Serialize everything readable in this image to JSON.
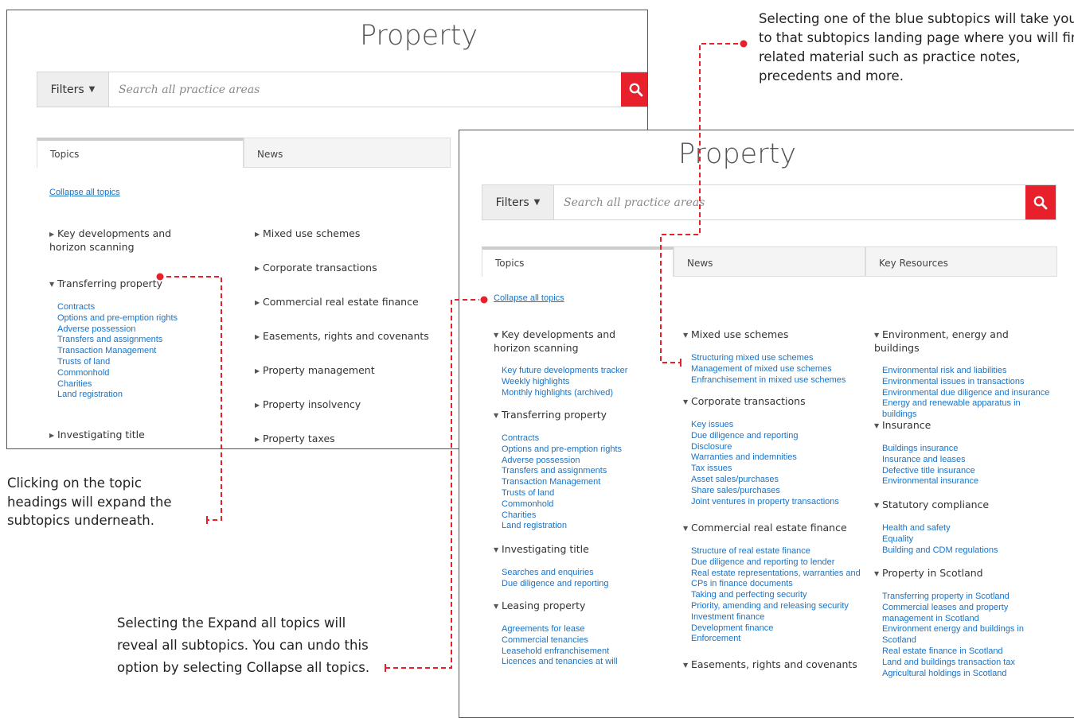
{
  "page_title": "Property",
  "search": {
    "filters_label": "Filters",
    "placeholder": "Search all practice areas"
  },
  "tabs_front": [
    "Topics",
    "News"
  ],
  "tabs_back": [
    "Topics",
    "News",
    "Key Resources"
  ],
  "collapse_label": "Collapse all topics",
  "front_col1": [
    {
      "title": "Key developments and horizon scanning",
      "expanded": false,
      "subs": []
    },
    {
      "title": "Transferring property",
      "expanded": true,
      "subs": [
        "Contracts",
        "Options and pre-emption rights",
        "Adverse possession",
        "Transfers and assignments",
        "Transaction Management",
        "Trusts of land",
        "Commonhold",
        "Charities",
        "Land registration"
      ]
    },
    {
      "title": "Investigating title",
      "expanded": false,
      "subs": []
    }
  ],
  "front_col2": [
    "Mixed use schemes",
    "Corporate transactions",
    "Commercial real estate finance",
    "Easements, rights and covenants",
    "Property management",
    "Property insolvency",
    "Property taxes"
  ],
  "back_col1": [
    {
      "title": "Key developments and horizon scanning",
      "subs": [
        "Key future developments tracker",
        "Weekly highlights",
        "Monthly highlights (archived)"
      ]
    },
    {
      "title": "Transferring property",
      "subs": [
        "Contracts",
        "Options and pre-emption rights",
        "Adverse possession",
        "Transfers and assignments",
        "Transaction Management",
        "Trusts of land",
        "Commonhold",
        "Charities",
        "Land registration"
      ]
    },
    {
      "title": "Investigating title",
      "subs": [
        "Searches and enquiries",
        "Due diligence and reporting"
      ]
    },
    {
      "title": "Leasing property",
      "subs": [
        "Agreements for lease",
        "Commercial tenancies",
        "Leasehold enfranchisement",
        "Licences and tenancies at will"
      ]
    }
  ],
  "back_col2": [
    {
      "title": "Mixed use schemes",
      "subs": [
        "Structuring mixed use schemes",
        "Management of mixed use schemes",
        "Enfranchisement in mixed use schemes"
      ]
    },
    {
      "title": "Corporate transactions",
      "subs": [
        "Key issues",
        "Due diligence and reporting",
        "Disclosure",
        "Warranties and indemnities",
        "Tax issues",
        "Asset sales/purchases",
        "Share sales/purchases",
        "Joint ventures in property transactions"
      ]
    },
    {
      "title": "Commercial real estate finance",
      "subs": [
        "Structure of real estate finance",
        "Due diligence and reporting to lender",
        "Real estate representations, warranties and CPs in finance documents",
        "Taking and perfecting security",
        "Priority, amending and releasing security",
        "Investment finance",
        "Development finance",
        "Enforcement"
      ]
    },
    {
      "title": "Easements, rights and covenants",
      "subs": []
    }
  ],
  "back_col3": [
    {
      "title": "Environment, energy and buildings",
      "subs": [
        "Environmental risk and liabilities",
        "Environmental issues in transactions",
        "Environmental due diligence and insurance",
        "Energy and renewable apparatus in buildings"
      ]
    },
    {
      "title": "Insurance",
      "subs": [
        "Buildings insurance",
        "Insurance and leases",
        "Defective title insurance",
        "Environmental insurance"
      ]
    },
    {
      "title": "Statutory compliance",
      "subs": [
        "Health and safety",
        "Equality",
        "Building and CDM regulations"
      ]
    },
    {
      "title": "Property in Scotland",
      "subs": [
        "Transferring property in Scotland",
        "Commercial leases and property management in Scotland",
        "Environment energy and buildings in Scotland",
        "Real estate finance in Scotland",
        "Land and buildings transaction tax",
        "Agricultural holdings in Scotland"
      ]
    }
  ],
  "notes": {
    "subtopics": "Selecting one of the blue subtopics will take you to that subtopics landing page where you will find related material such as practice notes, precedents and more.",
    "headings": "Clicking on the topic headings will expand the subtopics underneath.",
    "expand": "Selecting the Expand all topics will reveal all subtopics. You can undo this option by selecting Collapse all topics."
  },
  "accent_red": "#e8202b",
  "link_blue": "#1a73c6",
  "icons": {
    "search": "search-icon",
    "caret": "caret-down-icon",
    "expand": "triangle-right-icon",
    "collapse": "triangle-down-icon"
  }
}
